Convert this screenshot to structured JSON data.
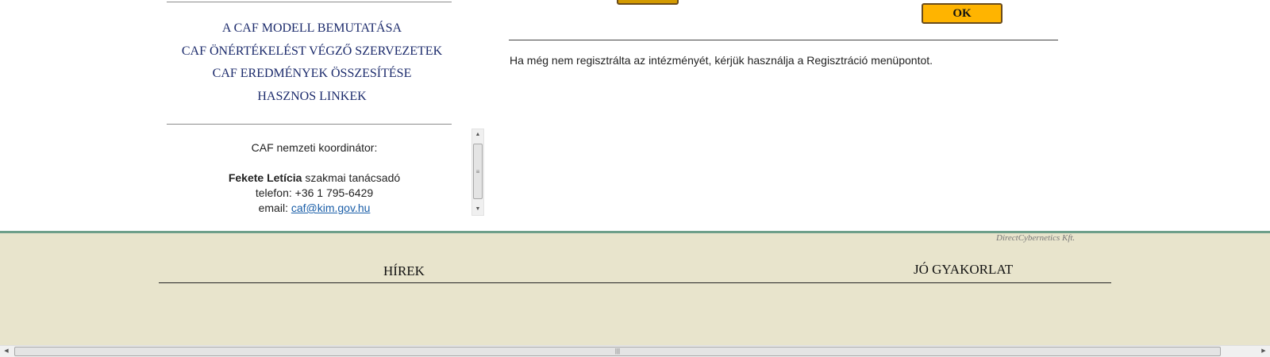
{
  "menu": {
    "items": [
      "A CAF MODELL BEMUTATÁSA",
      "CAF ÖNÉRTÉKELÉST VÉGZŐ SZERVEZETEK",
      "CAF EREDMÉNYEK ÖSSZESÍTÉSE",
      "HASZNOS LINKEK"
    ]
  },
  "coordinator": {
    "title": "CAF nemzeti koordinátor:",
    "name": "Fekete Letícia",
    "role": " szakmai tanácsadó",
    "phone": "telefon: +36 1 795-6429",
    "email_label": "email: ",
    "email": "caf@kim.gov.hu"
  },
  "login": {
    "ok_label": "OK"
  },
  "main": {
    "notice": "Ha még nem regisztrálta az intézményét, kérjük használja a Regisztráció menüpontot."
  },
  "footer": {
    "credit": "DirectCybernetics Kft.",
    "news_title": "HÍREK",
    "good_practice_title": "JÓ GYAKORLAT"
  },
  "scrollbars": {
    "up_icon": "▲",
    "down_icon": "▼",
    "left_icon": "◀",
    "right_icon": "▶",
    "grip_icon": "≡",
    "hgrip_icon": "|||"
  }
}
